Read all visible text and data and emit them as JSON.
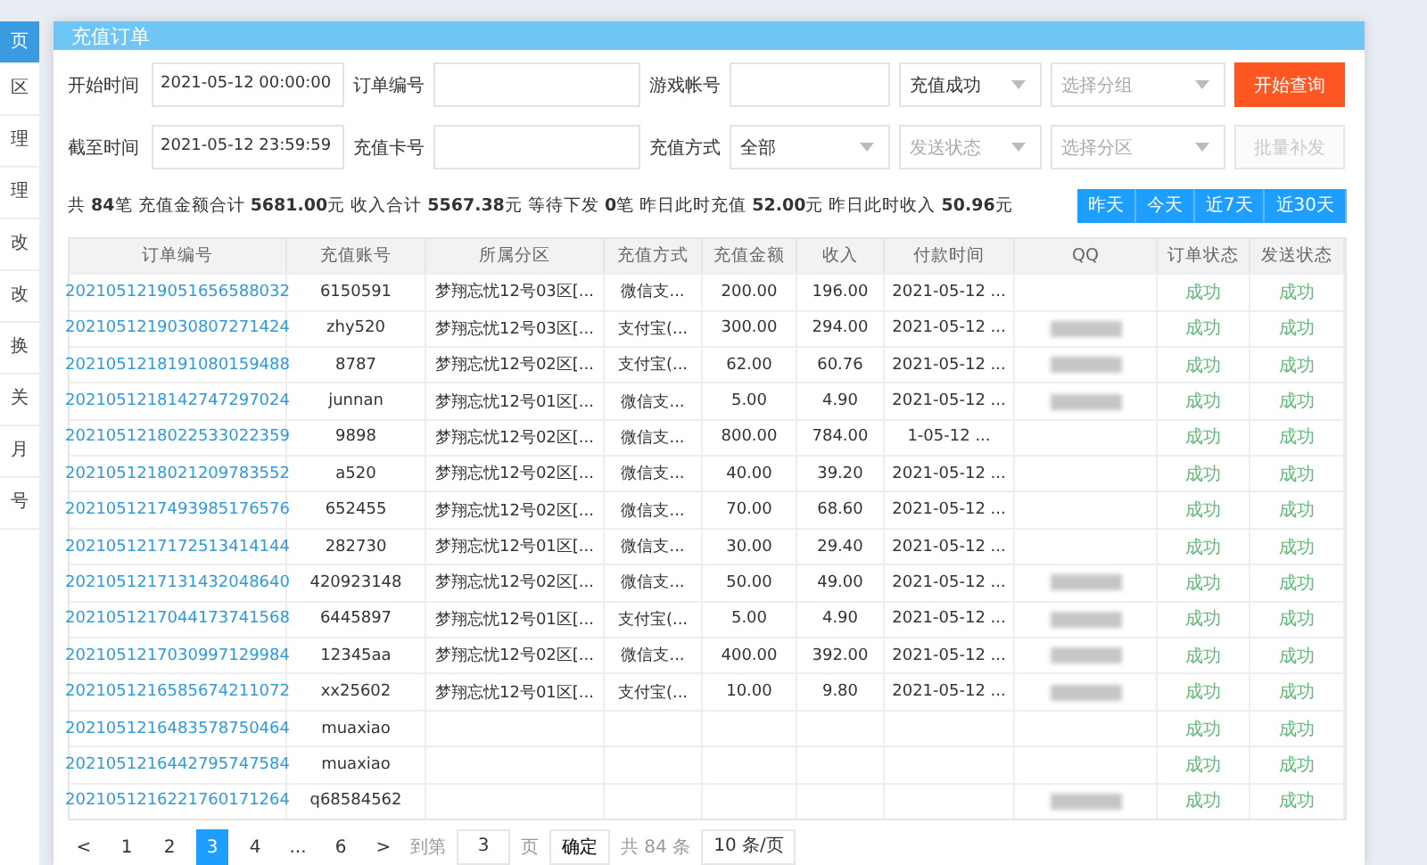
{
  "sidebar": {
    "items": [
      {
        "label": "页",
        "selected": true
      },
      {
        "label": "区",
        "selected": false
      },
      {
        "label": "理",
        "selected": false
      },
      {
        "label": "理",
        "selected": false
      },
      {
        "label": "改",
        "selected": false
      },
      {
        "label": "改",
        "selected": false
      },
      {
        "label": "换",
        "selected": false
      },
      {
        "label": "关",
        "selected": false
      },
      {
        "label": "月",
        "selected": false
      },
      {
        "label": "号",
        "selected": false
      }
    ]
  },
  "tab": {
    "title": "充值订单"
  },
  "filter_rows": [
    {
      "items": [
        {
          "kind": "label",
          "text": "开始时间"
        },
        {
          "kind": "input",
          "value": "2021-05-12 00:00:00"
        },
        {
          "kind": "label",
          "text": "订单编号"
        },
        {
          "kind": "input"
        },
        {
          "kind": "label",
          "text": "游戏帐号"
        },
        {
          "kind": "input"
        },
        {
          "kind": "select",
          "value": "充值成功"
        },
        {
          "kind": "select",
          "placeholder": "选择分组"
        },
        {
          "kind": "button",
          "label": "开始查询",
          "disabled": false
        }
      ]
    },
    {
      "items": [
        {
          "kind": "label",
          "text": "截至时间"
        },
        {
          "kind": "input",
          "value": "2021-05-12 23:59:59"
        },
        {
          "kind": "label",
          "text": "充值卡号"
        },
        {
          "kind": "input"
        },
        {
          "kind": "label",
          "text": "充值方式"
        },
        {
          "kind": "select",
          "value": "全部"
        },
        {
          "kind": "select",
          "placeholder": "发送状态"
        },
        {
          "kind": "select",
          "placeholder": "选择分区"
        },
        {
          "kind": "button",
          "label": "批量补发",
          "disabled": true
        }
      ]
    }
  ],
  "summary": "共 **84**笔 充值金额合计 **5681.00**元 收入合计 **5567.38**元 等待下发 **0**笔 昨日此时充值 **52.00**元 昨日此时收入 **50.96**元",
  "range_buttons": [
    "昨天",
    "今天",
    "近7天",
    "近30天"
  ],
  "table": {
    "columns": [
      "订单编号",
      "充值账号",
      "所属分区",
      "充值方式",
      "充值金额",
      "收入",
      "付款时间",
      "QQ",
      "订单状态",
      "发送状态"
    ],
    "rows": [
      {
        "order": "2021051219051656588032",
        "account": "6150591",
        "zone": "梦翔忘忧12号03区[...",
        "method": "微信支...",
        "amount": "200.00",
        "income": "196.00",
        "time": "2021-05-12 ...",
        "qq_blurred": false,
        "order_status": "成功",
        "send_status": "成功"
      },
      {
        "order": "2021051219030807271424",
        "account": "zhy520",
        "zone": "梦翔忘忧12号03区[...",
        "method": "支付宝(...",
        "amount": "300.00",
        "income": "294.00",
        "time": "2021-05-12 ...",
        "qq_blurred": true,
        "order_status": "成功",
        "send_status": "成功"
      },
      {
        "order": "2021051218191080159488",
        "account": "8787",
        "zone": "梦翔忘忧12号02区[...",
        "method": "支付宝(...",
        "amount": "62.00",
        "income": "60.76",
        "time": "2021-05-12 ...",
        "qq_blurred": true,
        "order_status": "成功",
        "send_status": "成功"
      },
      {
        "order": "2021051218142747297024",
        "account": "junnan",
        "zone": "梦翔忘忧12号01区[...",
        "method": "微信支...",
        "amount": "5.00",
        "income": "4.90",
        "time": "2021-05-12 ...",
        "qq_blurred": true,
        "order_status": "成功",
        "send_status": "成功"
      },
      {
        "order": "2021051218022533022359",
        "account": "9898",
        "zone": "梦翔忘忧12号02区[...",
        "method": "微信支...",
        "amount": "800.00",
        "income": "784.00",
        "time": "1-05-12 ...",
        "qq_blurred": false,
        "order_status": "成功",
        "send_status": "成功"
      },
      {
        "order": "2021051218021209783552",
        "account": "a520",
        "zone": "梦翔忘忧12号02区[...",
        "method": "微信支...",
        "amount": "40.00",
        "income": "39.20",
        "time": "2021-05-12 ...",
        "qq_blurred": false,
        "order_status": "成功",
        "send_status": "成功"
      },
      {
        "order": "2021051217493985176576",
        "account": "652455",
        "zone": "梦翔忘忧12号02区[...",
        "method": "微信支...",
        "amount": "70.00",
        "income": "68.60",
        "time": "2021-05-12 ...",
        "qq_blurred": false,
        "order_status": "成功",
        "send_status": "成功"
      },
      {
        "order": "2021051217172513414144",
        "account": "282730",
        "zone": "梦翔忘忧12号01区[...",
        "method": "微信支...",
        "amount": "30.00",
        "income": "29.40",
        "time": "2021-05-12 ...",
        "qq_blurred": false,
        "order_status": "成功",
        "send_status": "成功"
      },
      {
        "order": "2021051217131432048640",
        "account": "420923148",
        "zone": "梦翔忘忧12号02区[...",
        "method": "微信支...",
        "amount": "50.00",
        "income": "49.00",
        "time": "2021-05-12 ...",
        "qq_blurred": true,
        "order_status": "成功",
        "send_status": "成功"
      },
      {
        "order": "2021051217044173741568",
        "account": "6445897",
        "zone": "梦翔忘忧12号01区[...",
        "method": "支付宝(...",
        "amount": "5.00",
        "income": "4.90",
        "time": "2021-05-12 ...",
        "qq_blurred": true,
        "order_status": "成功",
        "send_status": "成功"
      },
      {
        "order": "2021051217030997129984",
        "account": "12345aa",
        "zone": "梦翔忘忧12号02区[...",
        "method": "微信支...",
        "amount": "400.00",
        "income": "392.00",
        "time": "2021-05-12 ...",
        "qq_blurred": true,
        "order_status": "成功",
        "send_status": "成功"
      },
      {
        "order": "2021051216585674211072",
        "account": "xx25602",
        "zone": "梦翔忘忧12号01区[...",
        "method": "支付宝(...",
        "amount": "10.00",
        "income": "9.80",
        "time": "2021-05-12 ...",
        "qq_blurred": true,
        "order_status": "成功",
        "send_status": "成功"
      },
      {
        "order": "2021051216483578750464",
        "account": "muaxiao",
        "qq_blurred": false,
        "order_status": "成功",
        "send_status": "成功"
      },
      {
        "order": "2021051216442795747584",
        "account": "muaxiao",
        "qq_blurred": false,
        "order_status": "成功",
        "send_status": "成功"
      },
      {
        "order": "2021051216221760171264",
        "account": "q68584562",
        "qq_blurred": true,
        "order_status": "成功",
        "send_status": "成功"
      }
    ]
  },
  "pagination": {
    "prev": "<",
    "pages": [
      {
        "label": "1",
        "selected": false
      },
      {
        "label": "2",
        "selected": false
      },
      {
        "label": "3",
        "selected": true
      },
      {
        "label": "4",
        "selected": false
      },
      {
        "label": "...",
        "selected": false
      },
      {
        "label": "6",
        "selected": false
      }
    ],
    "next": ">",
    "goto_label": "到第",
    "goto_value": "3",
    "page_unit": "页",
    "confirm": "确定",
    "total": "共 84 条",
    "page_size": "10 条/页"
  }
}
